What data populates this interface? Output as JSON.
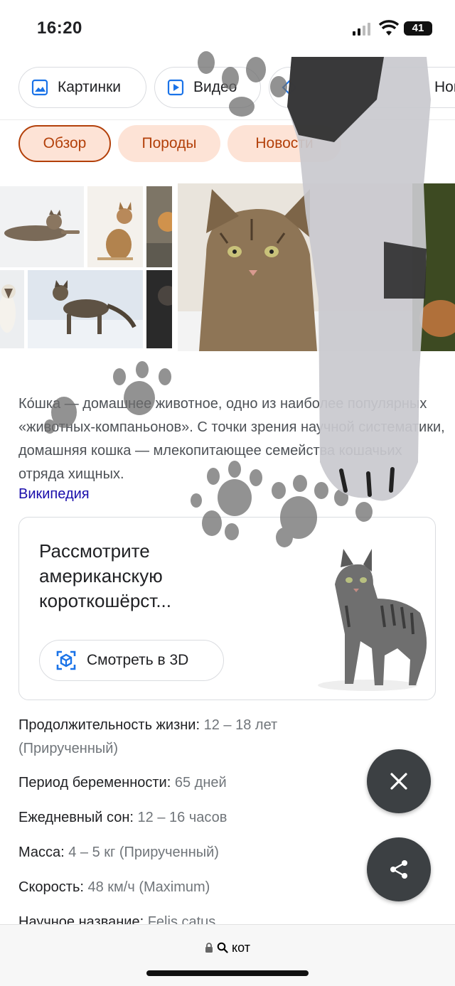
{
  "status": {
    "time": "16:20",
    "battery": "41"
  },
  "tabs1": [
    {
      "label": "Картинки",
      "icon": "image-icon"
    },
    {
      "label": "Видео",
      "icon": "video-icon"
    },
    {
      "label": "Новости",
      "icon": "news-icon"
    }
  ],
  "tabs2": [
    {
      "label": "Обзор",
      "active": true
    },
    {
      "label": "Породы",
      "active": false
    },
    {
      "label": "Новости",
      "active": false
    }
  ],
  "knowledge": {
    "description": "Ко́шка — домашнее животное, одно из наиболее популярных «животных-компаньонов». С точки зрения научной систематики, домашняя кошка — млекопитающее семейства кошачьих отряда хищных.",
    "source": "Википедия"
  },
  "card3d": {
    "title": "Рассмотрите американскую короткошёрст...",
    "button": "Смотреть в 3D"
  },
  "facts": [
    {
      "label": "Продолжительность жизни:",
      "value": "12 – 18 лет",
      "value2": "(Прирученный)"
    },
    {
      "label": "Период беременности:",
      "value": "65 дней"
    },
    {
      "label": "Ежедневный сон:",
      "value": "12 – 16 часов"
    },
    {
      "label": "Масса:",
      "value": "4 – 5 кг (Прирученный)"
    },
    {
      "label": "Скорость:",
      "value": "48 км/ч (Maximum)"
    },
    {
      "label": "Научное название:",
      "value": "Felis catus"
    }
  ],
  "urlbar": {
    "query": "кот"
  },
  "colors": {
    "accent": "#b3400a",
    "pill_bg": "#fde3d6",
    "link": "#1a0dab",
    "fab": "#3c4043"
  }
}
